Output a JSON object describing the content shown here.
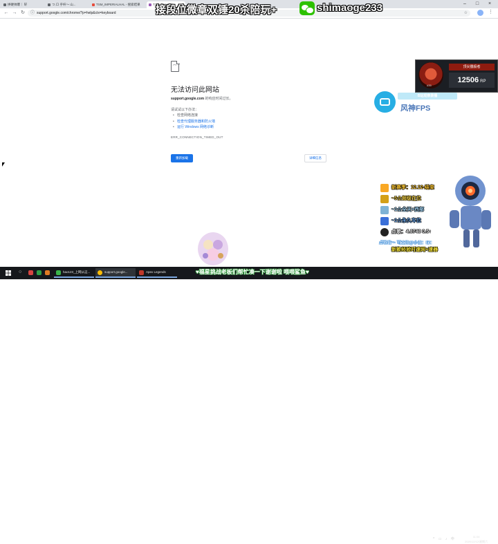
{
  "browser": {
    "tabs": [
      {
        "label": "拼硬帅爆｜ 轩"
      },
      {
        "label": "つ.ロ 乎杆～ 山..."
      },
      {
        "label": "TSM_IMPERIALHAL - 搜索结果"
      },
      {
        "label": "TSM_Imperial..."
      }
    ],
    "new_tab_symbol": "+",
    "window_controls": {
      "minimize": "–",
      "maximize": "□",
      "close": "×"
    },
    "url": "support.google.com/chrome/?p=help&ctx=keyboard"
  },
  "overlay_banner": {
    "text": "接段位微章双锤20杀陪玩+",
    "wechat_id": "shimaoge233"
  },
  "error_page": {
    "title": "无法访问此网站",
    "host": "support.google.com",
    "host_suffix": " 的响应时间过长。",
    "try_label": "请试试以下办法：",
    "suggestions": [
      "检查网络连接",
      "检查代理服务器和防火墙",
      "运行 Windows 网络诊断"
    ],
    "error_code": "ERR_CONNECTION_TIMED_OUT",
    "reload_label": "重新加载",
    "details_label": "详细信息"
  },
  "rank_card": {
    "tier_number": "#35",
    "tier_label": "顶尖獵殺者",
    "rp_value": "12506",
    "rp_unit": "RP"
  },
  "bilibili": {
    "tag": "B站观察录播",
    "name": "风神FPS"
  },
  "side_menu": {
    "items": [
      {
        "label": "新赛季：12.12-结束",
        "color": "#f6c234"
      },
      {
        "label": "~5☆超级在位",
        "color": "#f3d14a"
      },
      {
        "label": "~1☆全天+西部",
        "color": "#9fd0f0"
      },
      {
        "label": "~1☆永久车位",
        "color": "#6aa4e6"
      },
      {
        "label": "点歌：4.8748 0.5↑",
        "color": "#f0f0f0"
      }
    ],
    "note": "点歌谁～ 可交流@小白：ID：",
    "accelerator": "新款经验时速网+速器"
  },
  "taskbar": {
    "apps": [
      {
        "label": "hao123_上网从这..."
      },
      {
        "label": "support.google..."
      },
      {
        "label": "Apex Legends"
      }
    ],
    "ticker": "♥福星挑战老板们帮忙凑一下谢谢啦 喂喂鲨鱼♥",
    "time": "11:04",
    "date": "2020/12/12/星期六"
  }
}
